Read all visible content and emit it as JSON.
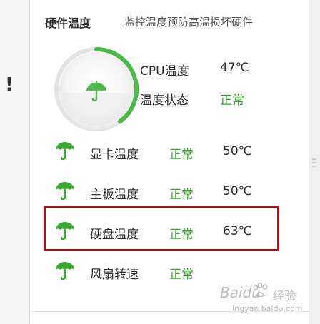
{
  "header": {
    "title": "硬件温度",
    "subtitle": "监控温度预防高温损坏硬件"
  },
  "left_panel": {
    "warning_mark": "!"
  },
  "cpu": {
    "temp_label": "CPU温度",
    "temp_value": "47℃",
    "status_label": "温度状态",
    "status_value": "正常",
    "gauge_level_fraction": 0.4
  },
  "rows": [
    {
      "label": "显卡温度",
      "status": "正常",
      "value": "50℃"
    },
    {
      "label": "主板温度",
      "status": "正常",
      "value": "50℃"
    },
    {
      "label": "硬盘温度",
      "status": "正常",
      "value": "63℃"
    },
    {
      "label": "风扇转速",
      "status": "正常",
      "value": ""
    }
  ],
  "watermark": {
    "brand": "Baidu",
    "suffix": "经验",
    "url": "jingyan.baidu.com"
  },
  "colors": {
    "accent_green": "#3aa832",
    "highlight_red": "#a4121c",
    "text": "#333333"
  },
  "icons": {
    "status_icon": "umbrella-icon"
  }
}
